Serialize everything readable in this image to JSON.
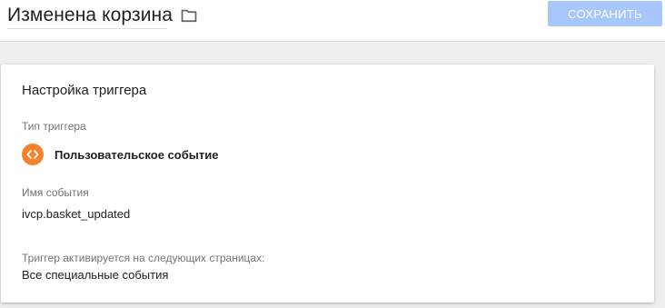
{
  "header": {
    "title": "Изменена корзина",
    "save_label": "СОХРАНИТЬ",
    "folder_icon": "folder-icon"
  },
  "trigger_config": {
    "title": "Настройка триггера",
    "type_label": "Тип триггера",
    "type_icon": "custom-event-icon",
    "type_icon_color": "#f5822a",
    "type_value": "Пользовательское событие",
    "event_name_label": "Имя события",
    "event_name_value": "ivcp.basket_updated",
    "fires_on_label": "Триггер активируется на следующих страницах:",
    "fires_on_value": "Все специальные события"
  },
  "colors": {
    "save_button_bg": "#a7c6fb",
    "accent_orange": "#f5822a"
  }
}
